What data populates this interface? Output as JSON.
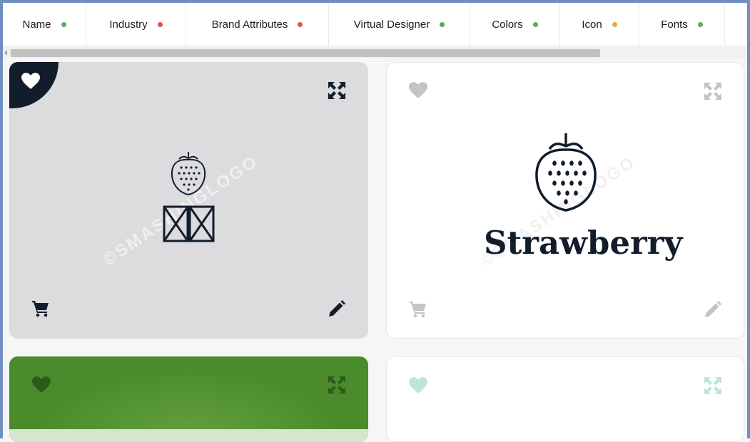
{
  "tabs": [
    {
      "label": "Name",
      "dot_color": "#5aac5a"
    },
    {
      "label": "Industry",
      "dot_color": "#d9534f"
    },
    {
      "label": "Brand Attributes",
      "dot_color": "#d9534f"
    },
    {
      "label": "Virtual Designer",
      "dot_color": "#5aac5a"
    },
    {
      "label": "Colors",
      "dot_color": "#5aac5a"
    },
    {
      "label": "Icon",
      "dot_color": "#e6a640"
    },
    {
      "label": "Fonts",
      "dot_color": "#5aac5a"
    }
  ],
  "watermark": "©SMASHINGLOGO",
  "cards": [
    {
      "background": "#dcdcdf",
      "logo_text": "",
      "icons": [
        "heart-icon",
        "expand-icon",
        "cart-icon",
        "pencil-icon"
      ],
      "favorited": true
    },
    {
      "background": "#ffffff",
      "logo_text": "Strawberry",
      "icons": [
        "heart-icon",
        "expand-icon",
        "cart-icon",
        "pencil-icon"
      ],
      "favorited": false
    },
    {
      "background": "#4a8c2b",
      "logo_text": "",
      "icons": [
        "heart-icon",
        "expand-icon"
      ],
      "favorited": false
    },
    {
      "background": "#ffffff",
      "logo_text": "",
      "icons": [
        "heart-icon",
        "expand-icon"
      ],
      "favorited": false
    }
  ],
  "colors": {
    "accent": "#111d2b",
    "frame": "#6f8fc2",
    "icon_muted": "#c4c4c4",
    "icon_teal": "#bfe3dd"
  }
}
